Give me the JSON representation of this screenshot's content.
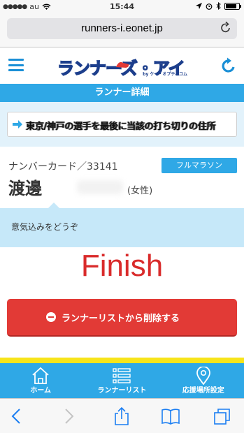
{
  "status_bar": {
    "carrier": "au",
    "time": "15:44"
  },
  "browser": {
    "url": "runners-i.eonet.jp"
  },
  "header": {
    "logo_text": "ランナーズ・アイ",
    "logo_sub": "by ケイ・オプティコム"
  },
  "section": {
    "title": "ランナー詳細"
  },
  "message": {
    "text": "東京/神戸の選手を最後に当該の打ち切りの住所"
  },
  "runner": {
    "number_label": "ナンバーカード／33141",
    "category": "フルマラソン",
    "name": "渡邊",
    "gender": "(女性)"
  },
  "comment": {
    "label": "意気込みをどうぞ"
  },
  "result": {
    "status": "Finish"
  },
  "actions": {
    "delete_label": "ランナーリストから削除する"
  },
  "nav": {
    "items": [
      {
        "label": "ホーム",
        "icon": "home-icon"
      },
      {
        "label": "ランナーリスト",
        "icon": "list-icon"
      },
      {
        "label": "応援場所設定",
        "icon": "map-pin-icon"
      }
    ]
  },
  "colors": {
    "accent": "#2fa8e6",
    "danger": "#e23a36",
    "finish": "#d92b2b",
    "strip": "#f7e41a"
  }
}
